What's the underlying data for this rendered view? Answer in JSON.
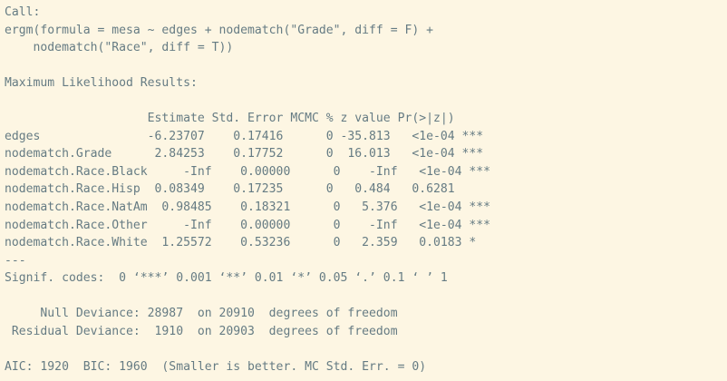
{
  "output": {
    "lines": [
      "Call:",
      "ergm(formula = mesa ~ edges + nodematch(\"Grade\", diff = F) + ",
      "    nodematch(\"Race\", diff = T))",
      "",
      "Maximum Likelihood Results:",
      "",
      "                    Estimate Std. Error MCMC % z value Pr(>|z|)    ",
      "edges               -6.23707    0.17416      0 -35.813   <1e-04 ***",
      "nodematch.Grade      2.84253    0.17752      0  16.013   <1e-04 ***",
      "nodematch.Race.Black     -Inf    0.00000      0    -Inf   <1e-04 ***",
      "nodematch.Race.Hisp  0.08349    0.17235      0   0.484   0.6281    ",
      "nodematch.Race.NatAm  0.98485    0.18321      0   5.376   <1e-04 ***",
      "nodematch.Race.Other     -Inf    0.00000      0    -Inf   <1e-04 ***",
      "nodematch.Race.White  1.25572    0.53236      0   2.359   0.0183 *  ",
      "---",
      "Signif. codes:  0 ‘***’ 0.001 ‘**’ 0.01 ‘*’ 0.05 ‘.’ 0.1 ‘ ’ 1",
      "",
      "     Null Deviance: 28987  on 20910  degrees of freedom",
      " Residual Deviance:  1910  on 20903  degrees of freedom",
      " ",
      "AIC: 1920  BIC: 1960  (Smaller is better. MC Std. Err. = 0)"
    ]
  }
}
